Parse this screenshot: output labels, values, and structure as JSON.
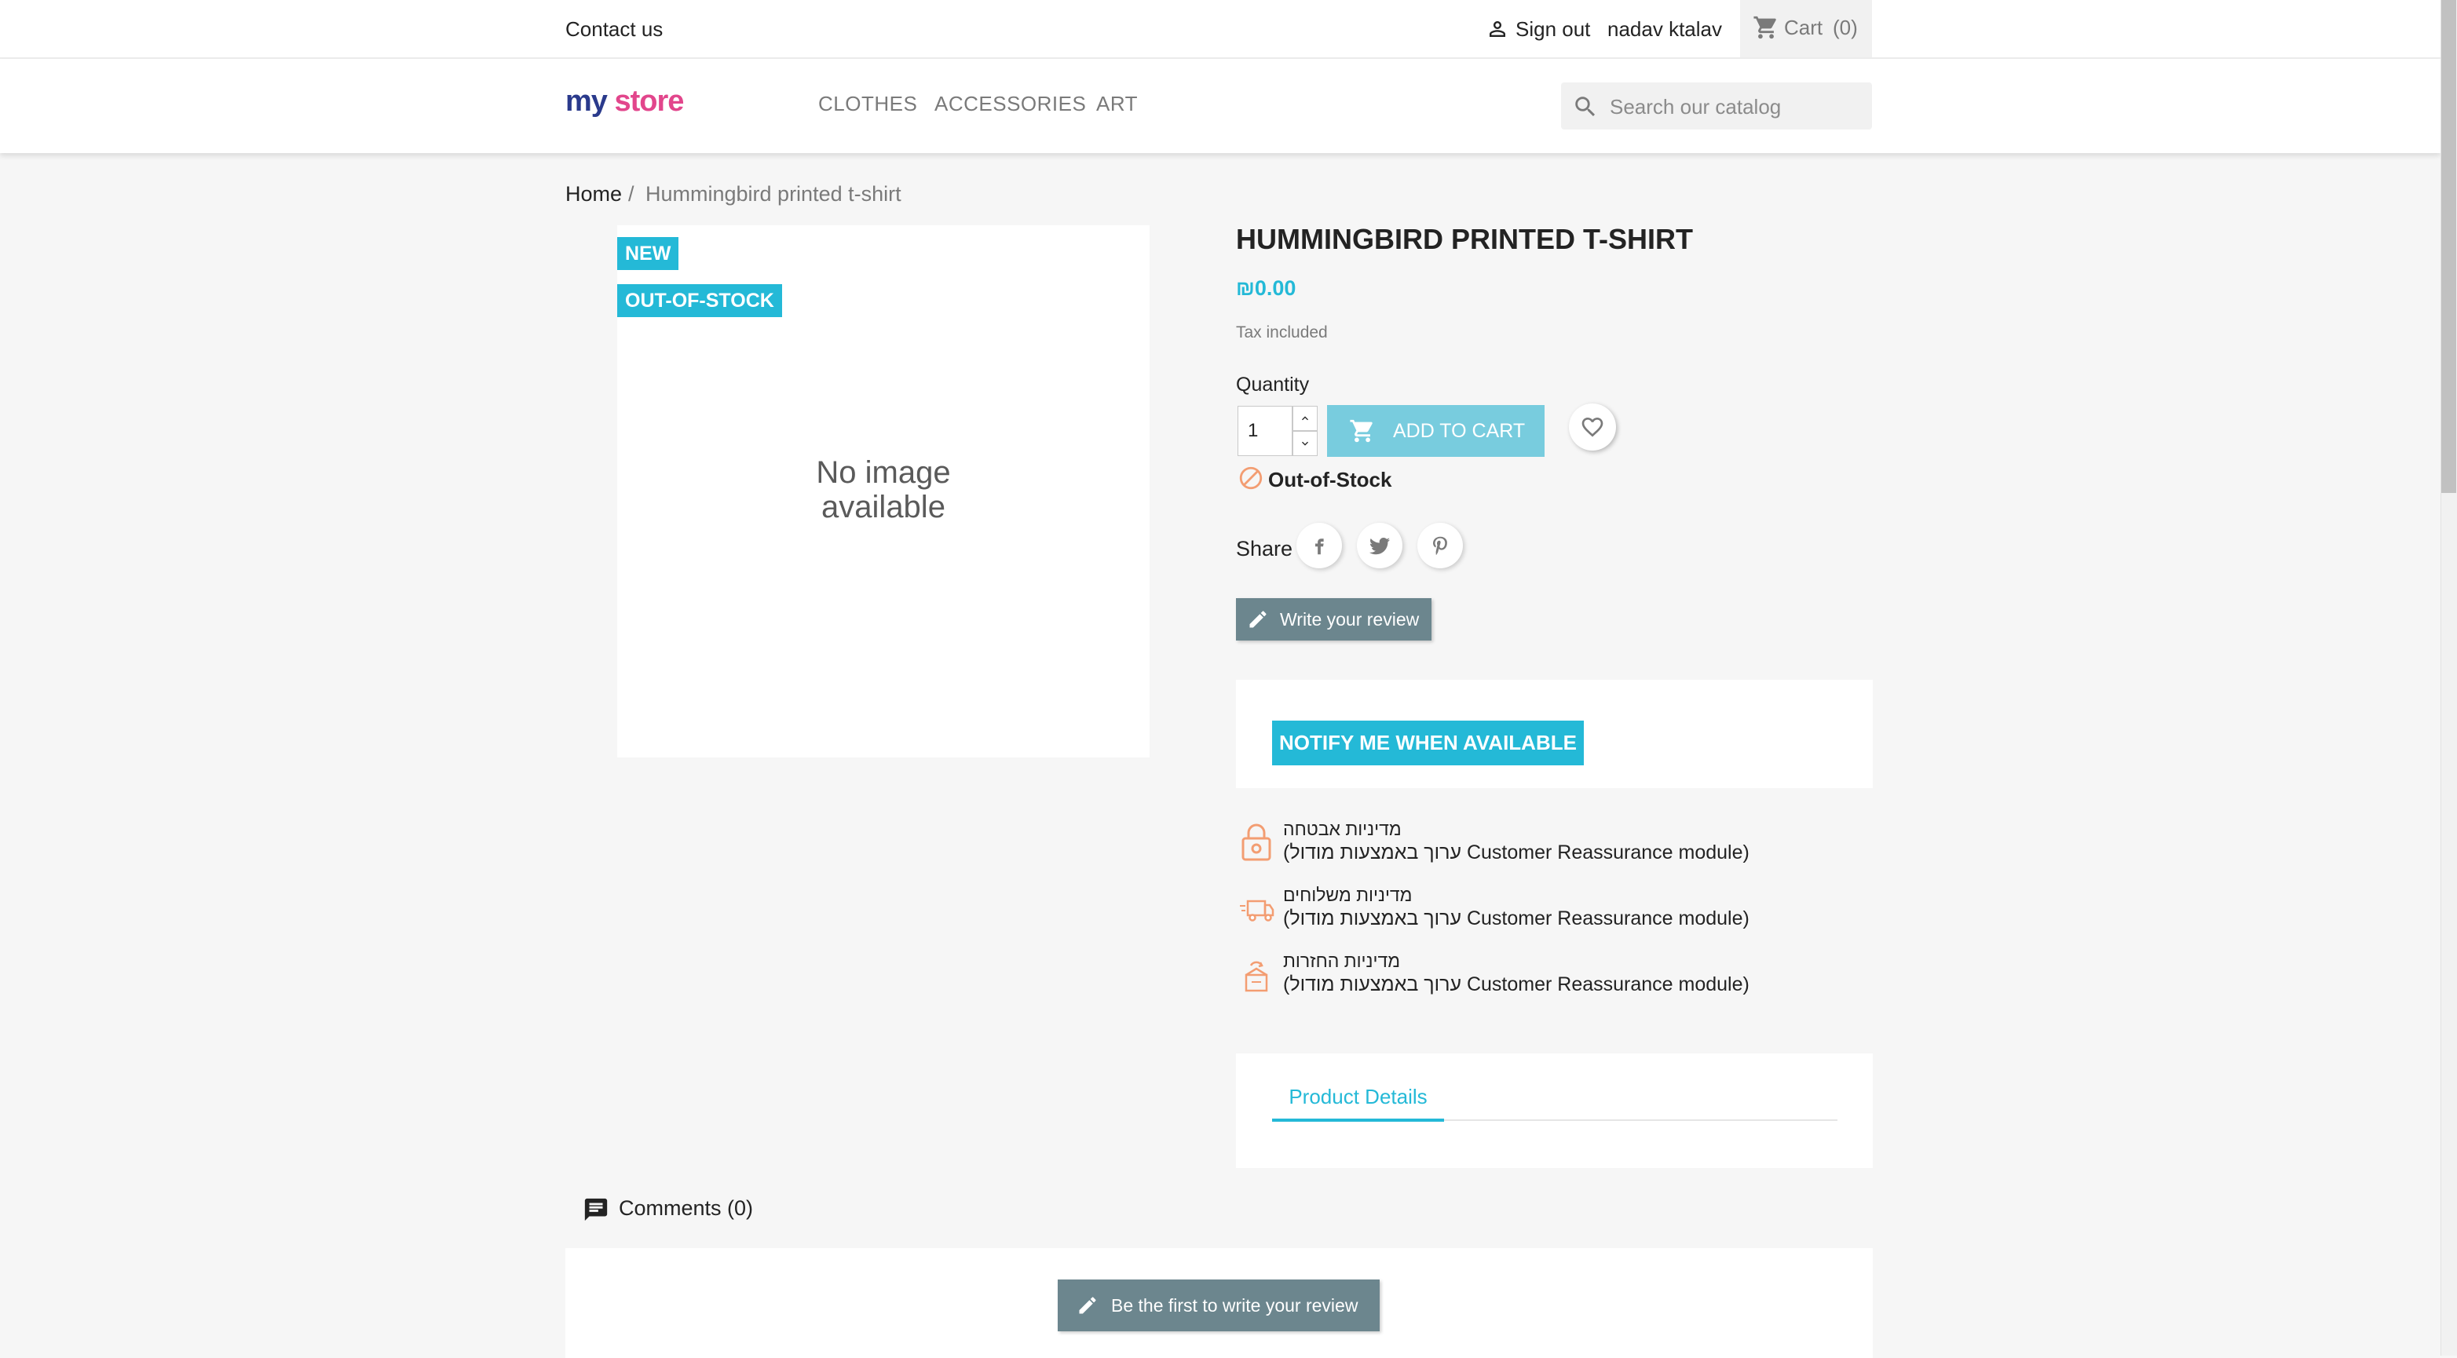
{
  "topbar": {
    "contact": "Contact us",
    "sign_out": "Sign out",
    "user_name": "nadav ktalav",
    "cart_label": "Cart",
    "cart_count": "(0)"
  },
  "header": {
    "logo_text_1": "my",
    "logo_text_2": "store",
    "nav": [
      "CLOTHES",
      "ACCESSORIES",
      "ART"
    ],
    "search_placeholder": "Search our catalog"
  },
  "breadcrumb": {
    "home": "Home",
    "separator": "/",
    "current": "Hummingbird printed t-shirt"
  },
  "product": {
    "flags": [
      "NEW",
      "OUT-OF-STOCK"
    ],
    "no_image_line1": "No image",
    "no_image_line2": "available",
    "title": "HUMMINGBIRD PRINTED T-SHIRT",
    "price": "₪0.00",
    "tax": "Tax included",
    "quantity_label": "Quantity",
    "quantity_value": "1",
    "add_to_cart": "ADD TO CART",
    "availability": "Out-of-Stock",
    "share_label": "Share",
    "write_review": "Write your review",
    "notify": "NOTIFY ME WHEN AVAILABLE"
  },
  "reassurance": [
    {
      "icon": "lock-icon",
      "title": "מדיניות אבטחה",
      "desc": "(ערוך באמצעות מודול Customer Reassurance module)"
    },
    {
      "icon": "truck-icon",
      "title": "מדיניות משלוחים",
      "desc": "(ערוך באמצעות מודול Customer Reassurance module)"
    },
    {
      "icon": "return-box-icon",
      "title": "מדיניות החזרות",
      "desc": "(ערוך באמצעות מודול Customer Reassurance module)"
    }
  ],
  "tabs": {
    "product_details": "Product Details"
  },
  "comments": {
    "label": "Comments (0)",
    "first_review": "Be the first to write your review"
  },
  "colors": {
    "accent": "#24b9d7",
    "add_to_cart_disabled": "#78ccde",
    "secondary_button": "#6c868e",
    "warning_orange": "#f39d72"
  }
}
